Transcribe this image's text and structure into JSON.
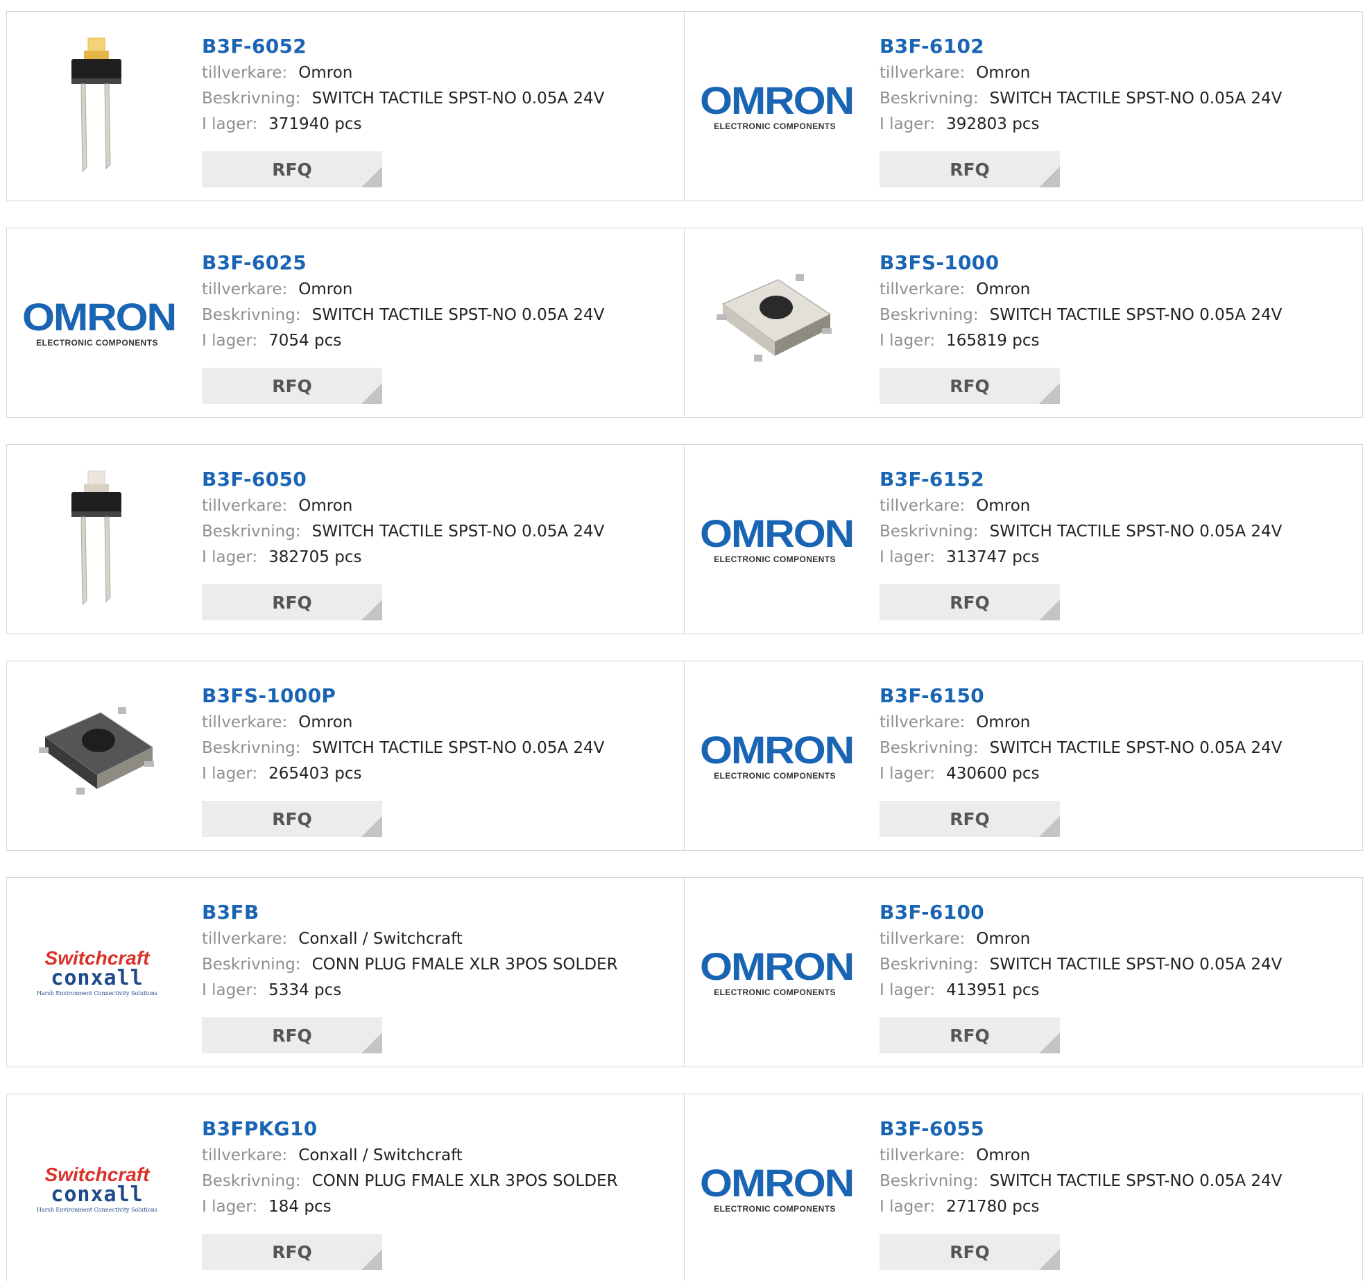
{
  "labels": {
    "manufacturer": "tillverkare:",
    "description": "Beskrivning:",
    "stock": "I lager:",
    "rfq": "RFQ",
    "omron_wordmark": "OMRON",
    "omron_tagline": "ELECTRONIC COMPONENTS",
    "sc_line1": "Switchcraft",
    "sc_line2": "conxall",
    "sc_tagline": "Harsh Environment Connectivity Solutions"
  },
  "colors": {
    "link": "#1a64b4",
    "label": "#8f8f8f",
    "button_bg": "#ececec",
    "switchcraft_red": "#d8322b",
    "conxall_blue": "#1f4a8a"
  },
  "products": [
    {
      "part": "B3F-6052",
      "manufacturer": "Omron",
      "description": "SWITCH TACTILE SPST-NO 0.05A 24V",
      "stock": "371940 pcs",
      "image": "tactile-switch-tall-yellow-icon"
    },
    {
      "part": "B3F-6102",
      "manufacturer": "Omron",
      "description": "SWITCH TACTILE SPST-NO 0.05A 24V",
      "stock": "392803 pcs",
      "image": "omron-logo"
    },
    {
      "part": "B3F-6025",
      "manufacturer": "Omron",
      "description": "SWITCH TACTILE SPST-NO 0.05A 24V",
      "stock": "7054 pcs",
      "image": "omron-logo"
    },
    {
      "part": "B3FS-1000",
      "manufacturer": "Omron",
      "description": "SWITCH TACTILE SPST-NO 0.05A 24V",
      "stock": "165819 pcs",
      "image": "smd-switch-silver-icon"
    },
    {
      "part": "B3F-6050",
      "manufacturer": "Omron",
      "description": "SWITCH TACTILE SPST-NO 0.05A 24V",
      "stock": "382705 pcs",
      "image": "tactile-switch-tall-beige-icon"
    },
    {
      "part": "B3F-6152",
      "manufacturer": "Omron",
      "description": "SWITCH TACTILE SPST-NO 0.05A 24V",
      "stock": "313747 pcs",
      "image": "omron-logo"
    },
    {
      "part": "B3FS-1000P",
      "manufacturer": "Omron",
      "description": "SWITCH TACTILE SPST-NO 0.05A 24V",
      "stock": "265403 pcs",
      "image": "smd-switch-dark-icon"
    },
    {
      "part": "B3F-6150",
      "manufacturer": "Omron",
      "description": "SWITCH TACTILE SPST-NO 0.05A 24V",
      "stock": "430600 pcs",
      "image": "omron-logo"
    },
    {
      "part": "B3FB",
      "manufacturer": "Conxall / Switchcraft",
      "description": "CONN PLUG FMALE XLR 3POS SOLDER",
      "stock": "5334 pcs",
      "image": "switchcraft-logo"
    },
    {
      "part": "B3F-6100",
      "manufacturer": "Omron",
      "description": "SWITCH TACTILE SPST-NO 0.05A 24V",
      "stock": "413951 pcs",
      "image": "omron-logo"
    },
    {
      "part": "B3FPKG10",
      "manufacturer": "Conxall / Switchcraft",
      "description": "CONN PLUG FMALE XLR 3POS SOLDER",
      "stock": "184 pcs",
      "image": "switchcraft-logo"
    },
    {
      "part": "B3F-6055",
      "manufacturer": "Omron",
      "description": "SWITCH TACTILE SPST-NO 0.05A 24V",
      "stock": "271780 pcs",
      "image": "omron-logo"
    }
  ]
}
